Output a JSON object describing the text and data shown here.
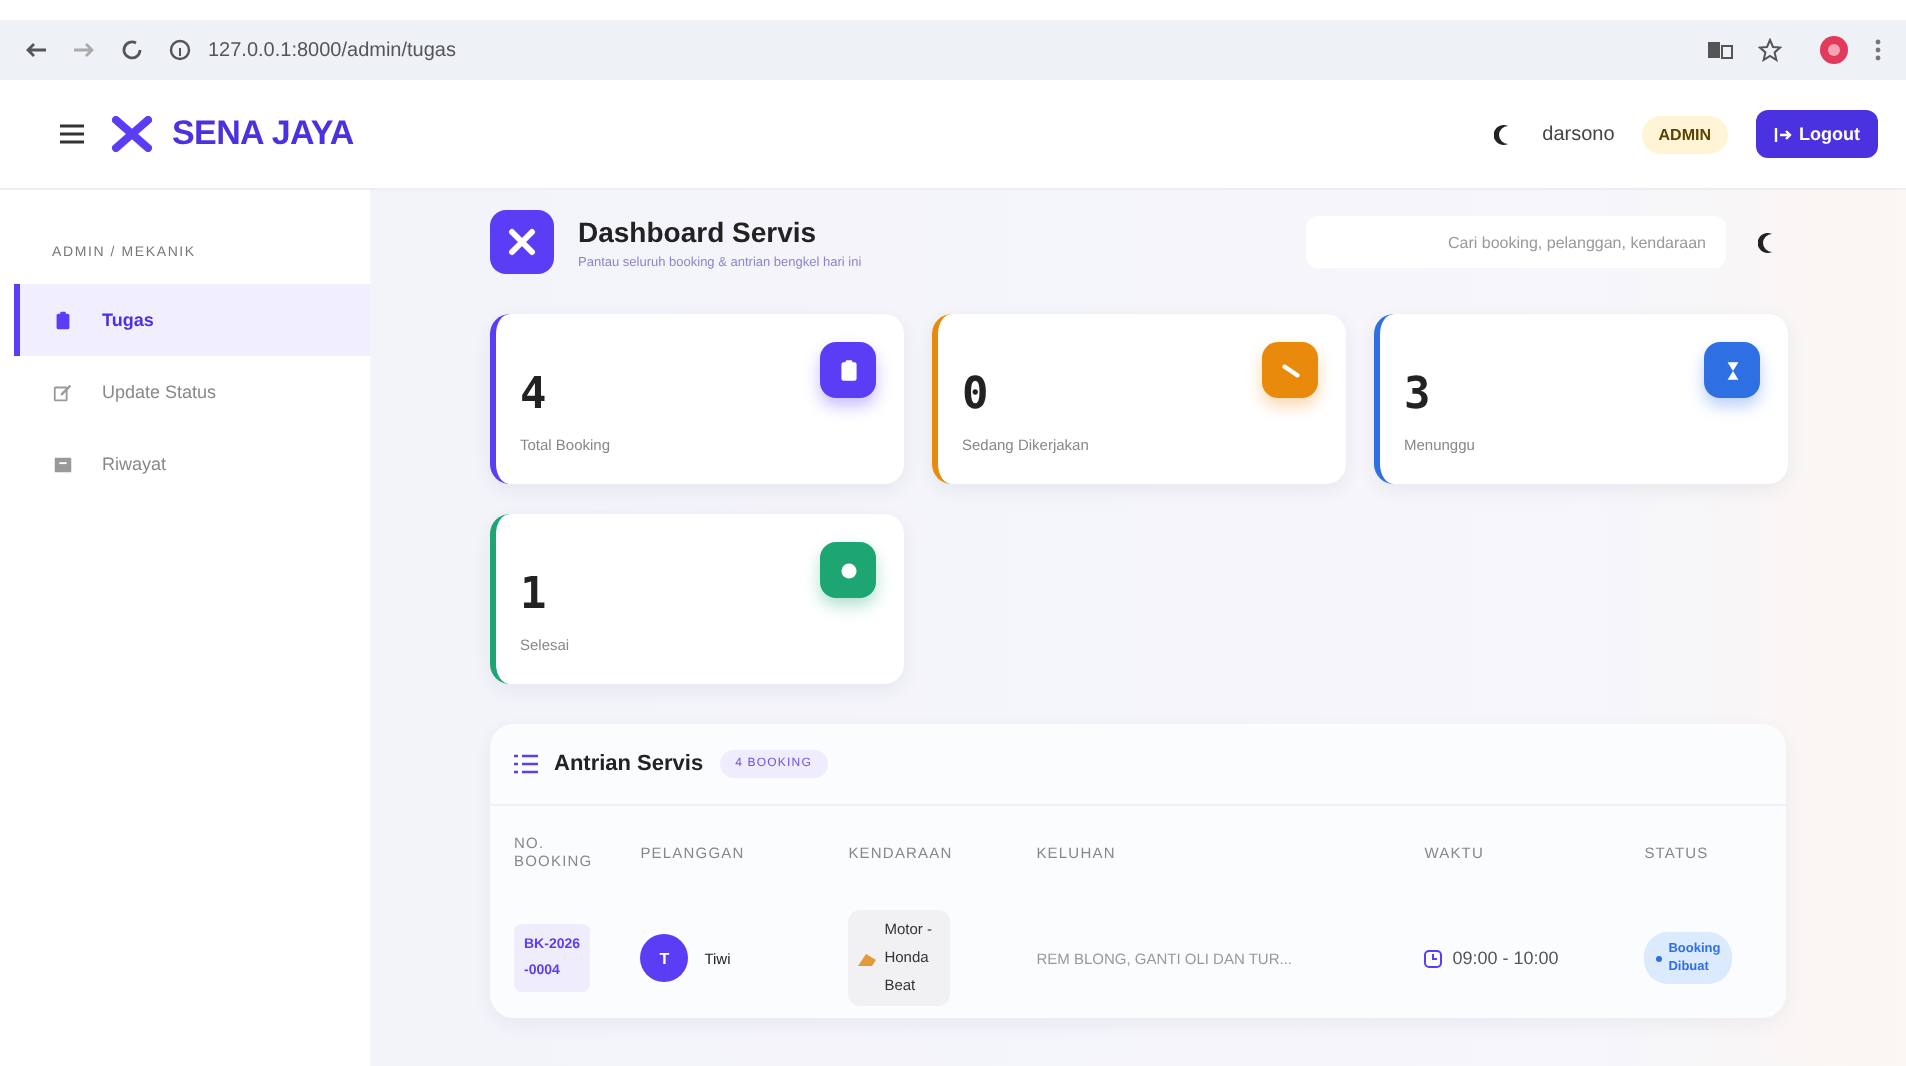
{
  "browser": {
    "url": "127.0.0.1:8000/admin/tugas"
  },
  "header": {
    "brand": "SENA JAYA",
    "user": "darsono",
    "role": "ADMIN",
    "logout": "Logout"
  },
  "sidebar": {
    "section": "ADMIN / MEKANIK",
    "items": [
      {
        "label": "Tugas",
        "selected": true
      },
      {
        "label": "Update Status",
        "selected": false
      },
      {
        "label": "Riwayat",
        "selected": false
      }
    ]
  },
  "page": {
    "title": "Dashboard Servis",
    "subtitle": "Pantau seluruh booking & antrian bengkel hari ini",
    "search": {
      "placeholder": "Cari booking, pelanggan, kendaraan"
    }
  },
  "stats": [
    {
      "value": "4",
      "label": "Total Booking",
      "color": "#5b3df5"
    },
    {
      "value": "0",
      "label": "Sedang Dikerjakan",
      "color": "#ea8a0c"
    },
    {
      "value": "3",
      "label": "Menunggu",
      "color": "#2f6fe4"
    },
    {
      "value": "1",
      "label": "Selesai",
      "color": "#1ea672"
    }
  ],
  "queue": {
    "title": "Antrian Servis",
    "badge": "4 BOOKING",
    "columns": [
      "NO. BOOKING",
      "PELANGGAN",
      "KENDARAAN",
      "KELUHAN",
      "WAKTU",
      "STATUS"
    ],
    "rows": [
      {
        "booking": "BK-2026-0004",
        "initial": "T",
        "customer": "Tiwi",
        "vehicle": "Motor - Honda Beat",
        "complaint": "REM BLONG, GANTI OLI DAN TUR...",
        "time": "09:00 - 10:00",
        "status": "Booking Dibuat"
      }
    ]
  }
}
